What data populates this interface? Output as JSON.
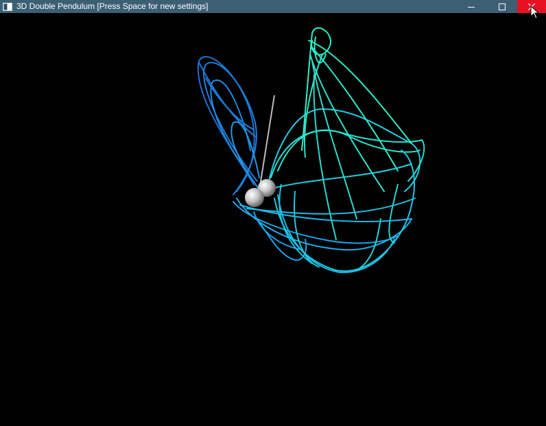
{
  "window": {
    "title": "3D Double Pendulum [Press Space for new settings]"
  },
  "icons": {
    "app": "app-window-icon",
    "minimize": "minimize-icon",
    "maximize": "maximize-icon",
    "close": "close-icon",
    "cursor": "mouse-pointer-icon"
  },
  "colors": {
    "titlebar": "#3d5f74",
    "close_hover": "#e81123",
    "background": "#000000",
    "trail_start": "#1a6fcf",
    "trail_mid": "#19b4e8",
    "trail_end": "#2ff0c8",
    "rod": "#bfbfbf",
    "bob": "#c8c8c8"
  }
}
